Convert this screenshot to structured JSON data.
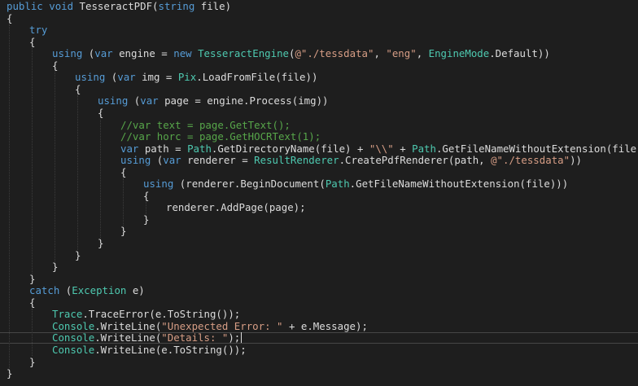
{
  "editor": {
    "theme_colors": {
      "background": "#1e1e1e",
      "plain": "#dcdcdc",
      "keyword": "#569cd6",
      "type": "#4ec9b0",
      "string": "#d69d85",
      "comment": "#57a64a"
    },
    "current_line_index": 28,
    "lines": [
      {
        "indent": 0,
        "tokens": [
          {
            "t": "public",
            "k": "keyword"
          },
          {
            "t": " "
          },
          {
            "t": "void",
            "k": "keyword"
          },
          {
            "t": " TesseractPDF("
          },
          {
            "t": "string",
            "k": "keyword"
          },
          {
            "t": " file)"
          }
        ]
      },
      {
        "indent": 0,
        "tokens": [
          {
            "t": "{"
          }
        ]
      },
      {
        "indent": 1,
        "tokens": [
          {
            "t": "try",
            "k": "keyword"
          }
        ]
      },
      {
        "indent": 1,
        "tokens": [
          {
            "t": "{"
          }
        ]
      },
      {
        "indent": 2,
        "tokens": [
          {
            "t": "using",
            "k": "keyword"
          },
          {
            "t": " ("
          },
          {
            "t": "var",
            "k": "keyword"
          },
          {
            "t": " engine = "
          },
          {
            "t": "new",
            "k": "keyword"
          },
          {
            "t": " "
          },
          {
            "t": "TesseractEngine",
            "k": "type"
          },
          {
            "t": "("
          },
          {
            "t": "@\"./tessdata\"",
            "k": "string"
          },
          {
            "t": ", "
          },
          {
            "t": "\"eng\"",
            "k": "string"
          },
          {
            "t": ", "
          },
          {
            "t": "EngineMode",
            "k": "type"
          },
          {
            "t": ".Default))"
          }
        ]
      },
      {
        "indent": 2,
        "tokens": [
          {
            "t": "{"
          }
        ]
      },
      {
        "indent": 3,
        "tokens": [
          {
            "t": "using",
            "k": "keyword"
          },
          {
            "t": " ("
          },
          {
            "t": "var",
            "k": "keyword"
          },
          {
            "t": " img = "
          },
          {
            "t": "Pix",
            "k": "type"
          },
          {
            "t": ".LoadFromFile(file))"
          }
        ]
      },
      {
        "indent": 3,
        "tokens": [
          {
            "t": "{"
          }
        ]
      },
      {
        "indent": 4,
        "tokens": [
          {
            "t": "using",
            "k": "keyword"
          },
          {
            "t": " ("
          },
          {
            "t": "var",
            "k": "keyword"
          },
          {
            "t": " page = engine.Process(img))"
          }
        ]
      },
      {
        "indent": 4,
        "tokens": [
          {
            "t": "{"
          }
        ]
      },
      {
        "indent": 5,
        "tokens": [
          {
            "t": "//var text = page.GetText();",
            "k": "comment"
          }
        ]
      },
      {
        "indent": 5,
        "tokens": [
          {
            "t": "//var horc = page.GetHOCRText(1);",
            "k": "comment"
          }
        ]
      },
      {
        "indent": 5,
        "tokens": [
          {
            "t": "var",
            "k": "keyword"
          },
          {
            "t": " path = "
          },
          {
            "t": "Path",
            "k": "type"
          },
          {
            "t": ".GetDirectoryName(file) + "
          },
          {
            "t": "\"\\\\\"",
            "k": "string"
          },
          {
            "t": " + "
          },
          {
            "t": "Path",
            "k": "type"
          },
          {
            "t": ".GetFileNameWithoutExtension(file);"
          }
        ]
      },
      {
        "indent": 5,
        "tokens": [
          {
            "t": "using",
            "k": "keyword"
          },
          {
            "t": " ("
          },
          {
            "t": "var",
            "k": "keyword"
          },
          {
            "t": " renderer = "
          },
          {
            "t": "ResultRenderer",
            "k": "type"
          },
          {
            "t": ".CreatePdfRenderer(path, "
          },
          {
            "t": "@\"./tessdata\"",
            "k": "string"
          },
          {
            "t": "))"
          }
        ]
      },
      {
        "indent": 5,
        "tokens": [
          {
            "t": "{"
          }
        ]
      },
      {
        "indent": 6,
        "tokens": [
          {
            "t": "using",
            "k": "keyword"
          },
          {
            "t": " (renderer.BeginDocument("
          },
          {
            "t": "Path",
            "k": "type"
          },
          {
            "t": ".GetFileNameWithoutExtension(file)))"
          }
        ]
      },
      {
        "indent": 6,
        "tokens": [
          {
            "t": "{"
          }
        ]
      },
      {
        "indent": 7,
        "tokens": [
          {
            "t": "renderer.AddPage(page);"
          }
        ]
      },
      {
        "indent": 6,
        "tokens": [
          {
            "t": "}"
          }
        ]
      },
      {
        "indent": 5,
        "tokens": [
          {
            "t": "}"
          }
        ]
      },
      {
        "indent": 4,
        "tokens": [
          {
            "t": "}"
          }
        ]
      },
      {
        "indent": 3,
        "tokens": [
          {
            "t": "}"
          }
        ]
      },
      {
        "indent": 2,
        "tokens": [
          {
            "t": "}"
          }
        ]
      },
      {
        "indent": 1,
        "tokens": [
          {
            "t": "}"
          }
        ]
      },
      {
        "indent": 1,
        "tokens": [
          {
            "t": "catch",
            "k": "keyword"
          },
          {
            "t": " ("
          },
          {
            "t": "Exception",
            "k": "type"
          },
          {
            "t": " e)"
          }
        ]
      },
      {
        "indent": 1,
        "tokens": [
          {
            "t": "{"
          }
        ]
      },
      {
        "indent": 2,
        "tokens": [
          {
            "t": "Trace",
            "k": "type"
          },
          {
            "t": ".TraceError(e.ToString());"
          }
        ]
      },
      {
        "indent": 2,
        "tokens": [
          {
            "t": "Console",
            "k": "type"
          },
          {
            "t": ".WriteLine("
          },
          {
            "t": "\"Unexpected Error: \"",
            "k": "string"
          },
          {
            "t": " + e.Message);"
          }
        ]
      },
      {
        "indent": 2,
        "tokens": [
          {
            "t": "Console",
            "k": "type"
          },
          {
            "t": ".WriteLine("
          },
          {
            "t": "\"Details: \"",
            "k": "string"
          },
          {
            "t": ");"
          }
        ]
      },
      {
        "indent": 2,
        "tokens": [
          {
            "t": "Console",
            "k": "type"
          },
          {
            "t": ".WriteLine(e.ToString());"
          }
        ]
      },
      {
        "indent": 1,
        "tokens": [
          {
            "t": "}"
          }
        ]
      },
      {
        "indent": 0,
        "tokens": [
          {
            "t": "}"
          }
        ]
      }
    ]
  }
}
